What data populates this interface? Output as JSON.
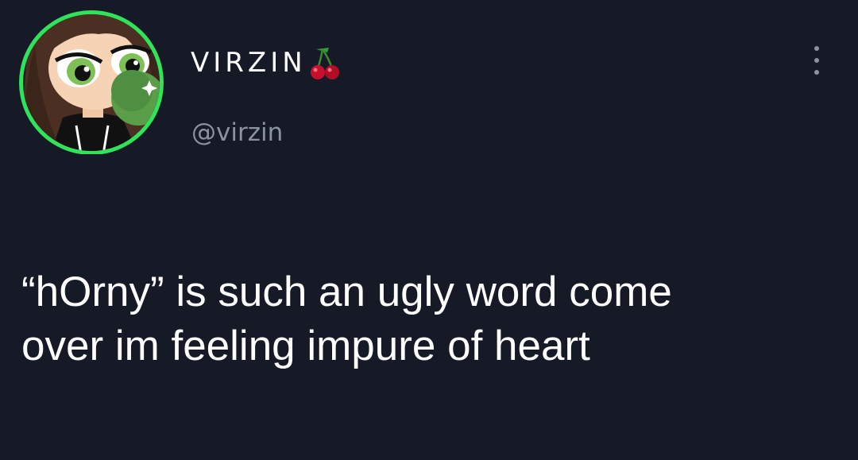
{
  "tweet": {
    "display_name": "VIRZIN",
    "handle": "@virzin",
    "text": "“hOrny” is such an ugly word come\nover im feeling impure of heart"
  },
  "icons": {
    "name_emoji": "cherry-icon",
    "menu": "more-options-icon",
    "avatar": "avatar"
  },
  "colors": {
    "background": "#151a26",
    "text": "#ffffff",
    "secondary_text": "#8c93a0",
    "avatar_ring": "#2fe35a",
    "cherry": "#c8102e"
  }
}
